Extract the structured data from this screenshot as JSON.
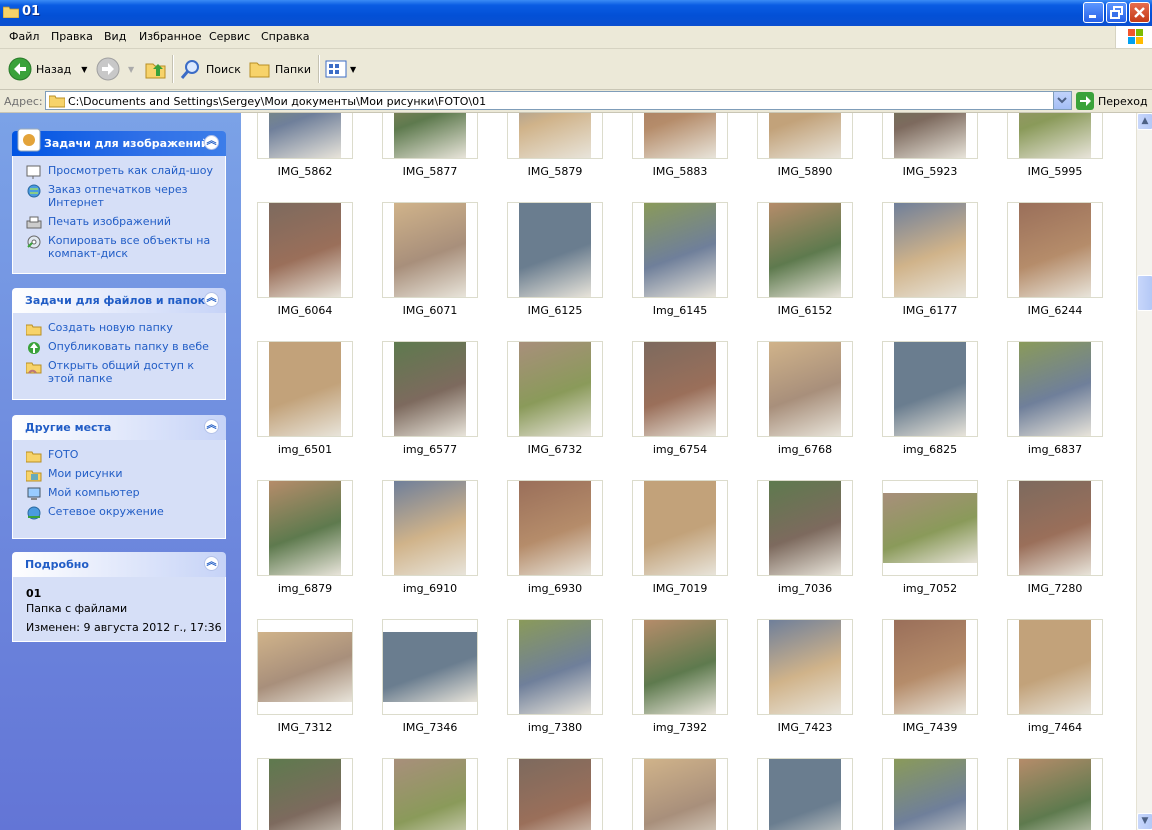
{
  "window": {
    "title": "01"
  },
  "menu": [
    "Файл",
    "Правка",
    "Вид",
    "Избранное",
    "Сервис",
    "Справка"
  ],
  "toolbar": {
    "back": "Назад",
    "search": "Поиск",
    "folders": "Папки"
  },
  "address": {
    "label": "Адрес:",
    "path": "C:\\Documents and Settings\\Sergey\\Мои документы\\Мои рисунки\\FOTO\\01",
    "go": "Переход"
  },
  "panels": {
    "image_tasks": {
      "title": "Задачи для изображений",
      "items": [
        "Просмотреть как слайд-шоу",
        "Заказ отпечатков через Интернет",
        "Печать изображений",
        "Копировать все объекты на компакт-диск"
      ]
    },
    "file_tasks": {
      "title": "Задачи для файлов и папок",
      "items": [
        "Создать новую папку",
        "Опубликовать папку в вебе",
        "Открыть общий доступ к этой папке"
      ]
    },
    "other_places": {
      "title": "Другие места",
      "items": [
        "FOTO",
        "Мои рисунки",
        "Мой компьютер",
        "Сетевое окружение"
      ]
    },
    "details": {
      "title": "Подробно",
      "name": "01",
      "type": "Папка с файлами",
      "modified": "Изменен: 9 августа 2012 г., 17:36"
    }
  },
  "files": [
    "IMG_5862",
    "IMG_5877",
    "IMG_5879",
    "IMG_5883",
    "IMG_5890",
    "IMG_5923",
    "IMG_5995",
    "IMG_6064",
    "IMG_6071",
    "IMG_6125",
    "Img_6145",
    "IMG_6152",
    "IMG_6177",
    "IMG_6244",
    "img_6501",
    "img_6577",
    "IMG_6732",
    "img_6754",
    "img_6768",
    "img_6825",
    "img_6837",
    "img_6879",
    "img_6910",
    "img_6930",
    "IMG_7019",
    "img_7036",
    "img_7052",
    "IMG_7280",
    "IMG_7312",
    "IMG_7346",
    "img_7380",
    "img_7392",
    "IMG_7423",
    "IMG_7439",
    "img_7464",
    "",
    "",
    "",
    "",
    "",
    "",
    ""
  ],
  "colors": {
    "title_bar": "#0a5ce3",
    "task_link": "#215dc6",
    "panel_bg": "#6f8ede"
  }
}
